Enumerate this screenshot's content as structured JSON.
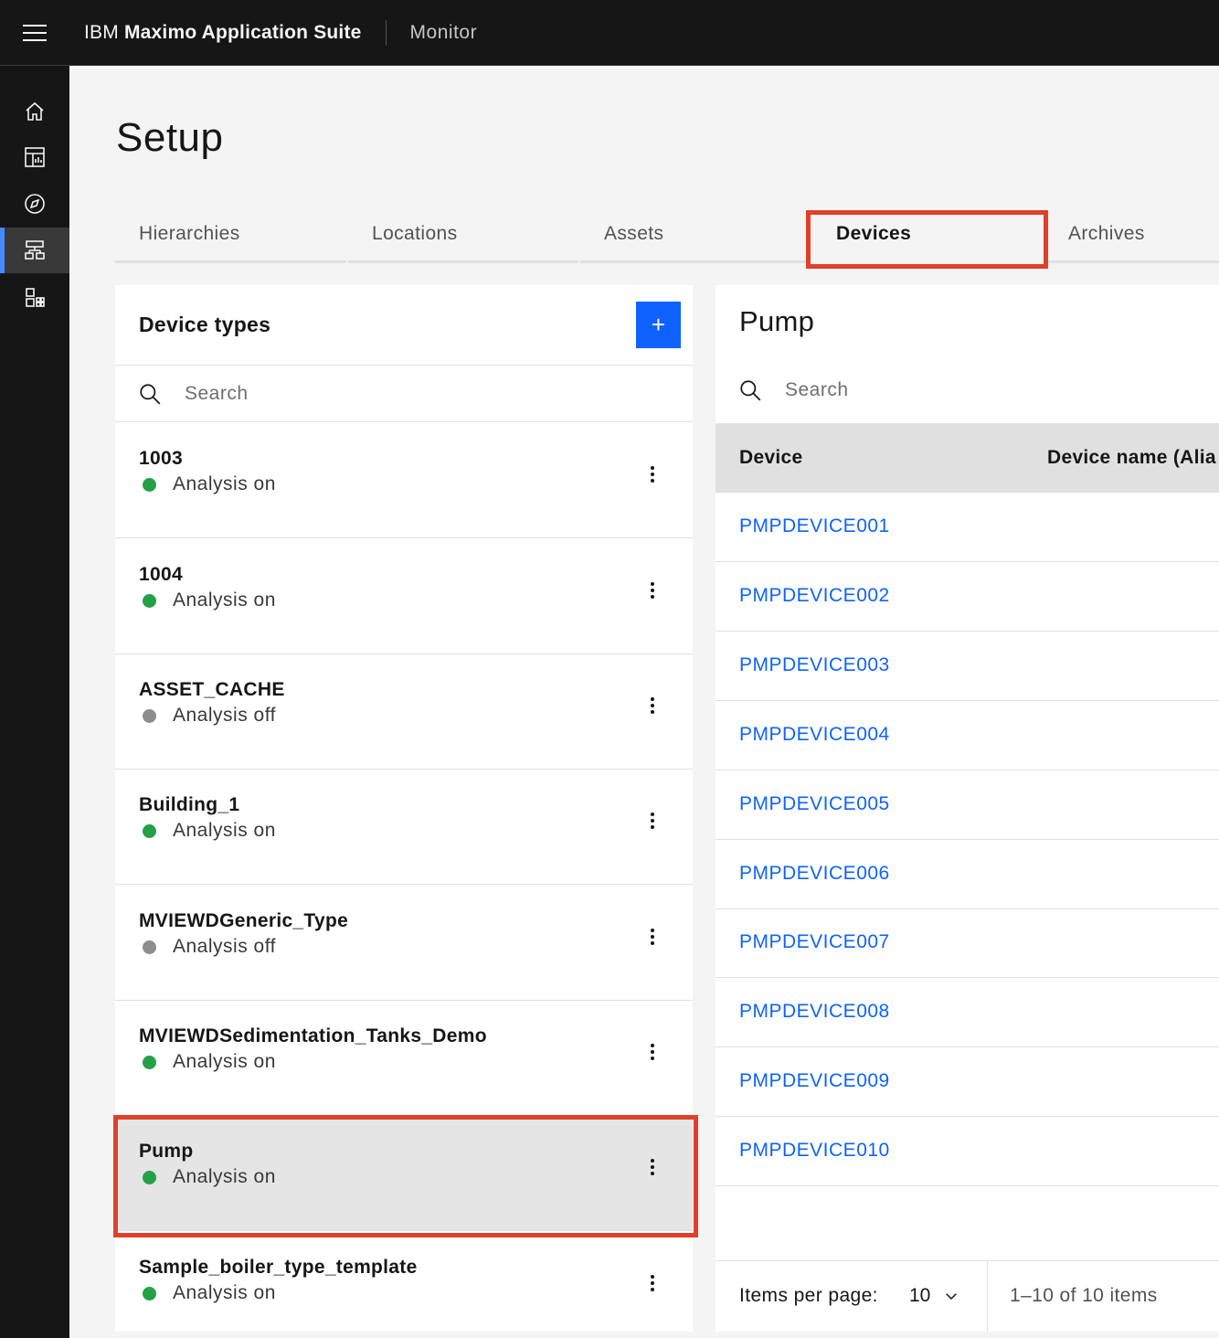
{
  "header": {
    "brand_prefix": "IBM",
    "brand_name": "Maximo Application Suite",
    "product": "Monitor"
  },
  "sidenav": {
    "items": [
      {
        "icon": "home-icon"
      },
      {
        "icon": "dashboard-icon"
      },
      {
        "icon": "compass-icon"
      },
      {
        "icon": "hierarchy-icon",
        "active": true
      },
      {
        "icon": "apps-icon"
      }
    ],
    "accent_color": "#4589ff"
  },
  "page": {
    "title": "Setup"
  },
  "tabs": [
    {
      "label": "Hierarchies"
    },
    {
      "label": "Locations"
    },
    {
      "label": "Assets"
    },
    {
      "label": "Devices",
      "selected": true
    },
    {
      "label": "Archives"
    }
  ],
  "device_types": {
    "title": "Device types",
    "add_label": "+",
    "search_placeholder": "Search",
    "items": [
      {
        "name": "1003",
        "status": "Analysis on"
      },
      {
        "name": "1004",
        "status": "Analysis on"
      },
      {
        "name": "ASSET_CACHE",
        "status": "Analysis off"
      },
      {
        "name": "Building_1",
        "status": "Analysis on"
      },
      {
        "name": "MVIEWDGeneric_Type",
        "status": "Analysis off"
      },
      {
        "name": "MVIEWDSedimentation_Tanks_Demo",
        "status": "Analysis on"
      },
      {
        "name": "Pump",
        "status": "Analysis on",
        "selected": true
      },
      {
        "name": "Sample_boiler_type_template",
        "status": "Analysis on"
      }
    ],
    "status_colors": {
      "on": "#24a148",
      "off": "#8d8d8d"
    }
  },
  "devices": {
    "title": "Pump",
    "search_placeholder": "Search",
    "columns": [
      "Device",
      "Device name (Alia"
    ],
    "rows": [
      "PMPDEVICE001",
      "PMPDEVICE002",
      "PMPDEVICE003",
      "PMPDEVICE004",
      "PMPDEVICE005",
      "PMPDEVICE006",
      "PMPDEVICE007",
      "PMPDEVICE008",
      "PMPDEVICE009",
      "PMPDEVICE010"
    ],
    "pagination": {
      "label": "Items per page:",
      "per_page": "10",
      "range": "1–10 of 10 items"
    },
    "link_color": "#0f62fe"
  },
  "annotation_color": "#e23f2b"
}
